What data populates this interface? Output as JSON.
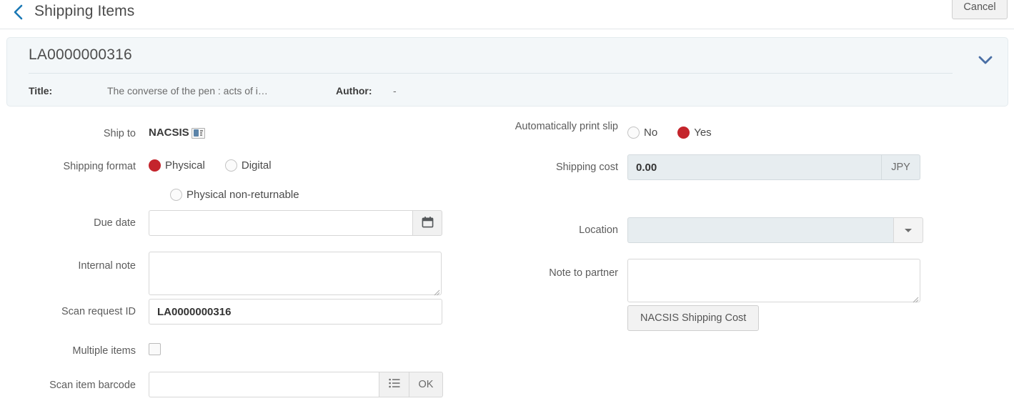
{
  "topbar": {
    "back_icon": "chevron-left-icon",
    "title": "Shipping Items",
    "cancel_label": "Cancel"
  },
  "record": {
    "id": "LA0000000316",
    "expand_icon": "chevron-down-icon",
    "meta": [
      {
        "label": "Title:",
        "value": "The converse of the pen : acts of i…"
      },
      {
        "label": "Author:",
        "value": "-"
      }
    ]
  },
  "form": {
    "ship_to": {
      "label": "Ship to",
      "value": "NACSIS",
      "icon": "id-card-icon"
    },
    "shipping_format": {
      "label": "Shipping format",
      "options": [
        {
          "label": "Physical",
          "selected": true
        },
        {
          "label": "Digital",
          "selected": false
        },
        {
          "label": "Physical non-returnable",
          "selected": false
        }
      ]
    },
    "due_date": {
      "label": "Due date",
      "value": "",
      "button_icon": "calendar-icon"
    },
    "internal_note": {
      "label": "Internal note",
      "value": ""
    },
    "scan_request_id": {
      "label": "Scan request ID",
      "value": "LA0000000316"
    },
    "multiple_items": {
      "label": "Multiple items",
      "checked": false
    },
    "scan_item_barcode": {
      "label": "Scan item barcode",
      "value": "",
      "list_icon": "list-icon",
      "ok_label": "OK"
    },
    "auto_print_slip": {
      "label": "Automatically print slip",
      "options": [
        {
          "label": "No",
          "selected": false
        },
        {
          "label": "Yes",
          "selected": true
        }
      ]
    },
    "shipping_cost": {
      "label": "Shipping cost",
      "value": "0.00",
      "currency": "JPY"
    },
    "location": {
      "label": "Location",
      "value": "",
      "dropdown_icon": "caret-down-icon"
    },
    "note_to_partner": {
      "label": "Note to partner",
      "value": ""
    },
    "nacsis_shipping_cost": {
      "label": "NACSIS Shipping Cost"
    }
  },
  "colors": {
    "accent_blue": "#1a78b5",
    "panel_blue": "#4a6fa5",
    "radio_red": "#c4252c",
    "panel_bg": "#f3f7f9"
  }
}
